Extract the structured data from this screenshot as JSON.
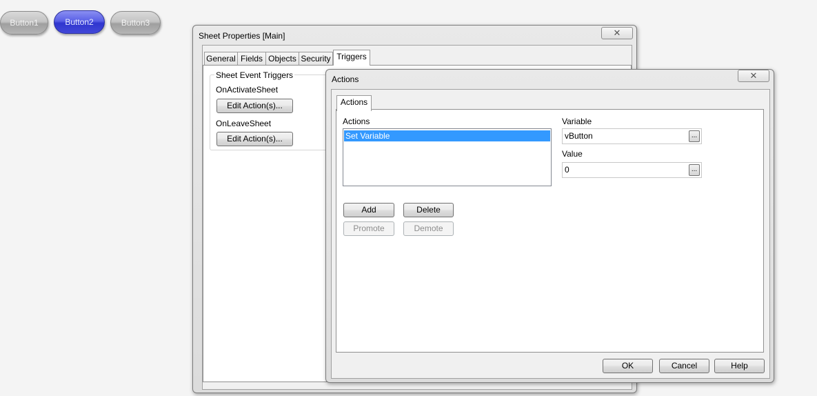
{
  "sheet_buttons": [
    "Button1",
    "Button2",
    "Button3"
  ],
  "sheet_props": {
    "title": "Sheet Properties [Main]",
    "tabs": [
      "General",
      "Fields",
      "Objects",
      "Security",
      "Triggers"
    ],
    "group_title": "Sheet Event Triggers",
    "on_activate_label": "OnActivateSheet",
    "on_leave_label": "OnLeaveSheet",
    "edit_actions_label": "Edit Action(s)..."
  },
  "actions_dialog": {
    "title": "Actions",
    "tab": "Actions",
    "list_label": "Actions",
    "list_items": [
      "Set Variable"
    ],
    "variable_label": "Variable",
    "variable_value": "vButton",
    "value_label": "Value",
    "value_value": "0",
    "ellipsis": "...",
    "add": "Add",
    "delete": "Delete",
    "promote": "Promote",
    "demote": "Demote",
    "ok": "OK",
    "cancel": "Cancel",
    "help": "Help"
  },
  "colors": {
    "selection": "#3399ff",
    "active_button": "#3a40d8"
  }
}
